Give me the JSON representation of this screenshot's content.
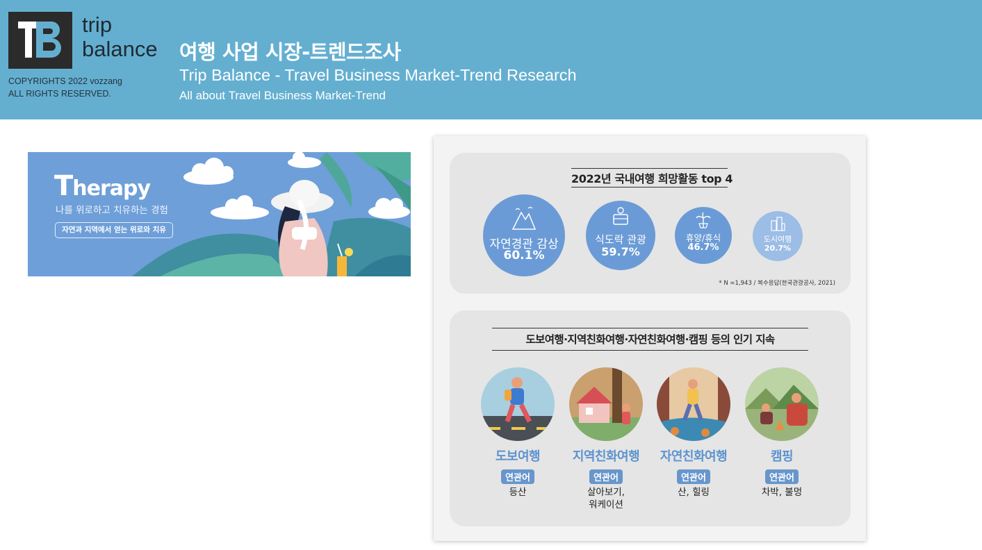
{
  "header": {
    "logo_initials": "TB",
    "logo_word_line1": "trip",
    "logo_word_line2": "balance",
    "copyright_line1": "COPYRIGHTS 2022 vozzang",
    "copyright_line2": "ALL RIGHTS RESERVED.",
    "title_ko": "여행 사업 시장-트렌드조사",
    "title_en": "Trip Balance - Travel Business Market-Trend Research",
    "subtitle": "All about Travel Business Market-Trend",
    "bg_color": "#64afd0"
  },
  "banner": {
    "title_first": "T",
    "title_rest": "herapy",
    "subtitle": "나를 위로하고 치유하는 경험",
    "pill": "자연과 지역에서 얻는 위로와 치유"
  },
  "infographic": {
    "top4": {
      "title": "2022년 국내여행 희망활동 top 4",
      "items": [
        {
          "label": "자연경관 감상",
          "value": "60.1%",
          "icon": "mountain-icon"
        },
        {
          "label": "식도락 관광",
          "value": "59.7%",
          "icon": "food-icon"
        },
        {
          "label": "휴양/휴식",
          "value": "46.7%",
          "icon": "palm-icon"
        },
        {
          "label": "도시여행",
          "value": "20.7%",
          "icon": "city-icon"
        }
      ],
      "note": "* N =1,943 / 복수응답(한국관광공사, 2021)",
      "bubble_color": "#6b9bd6"
    },
    "trends": {
      "title": "도보여행·지역친화여행·자연친화여행·캠핑 등의 인기 지속",
      "tag_label": "연관어",
      "items": [
        {
          "name": "도보여행",
          "keywords_line1": "등산",
          "keywords_line2": ""
        },
        {
          "name": "지역친화여행",
          "keywords_line1": "살아보기,",
          "keywords_line2": "워케이션"
        },
        {
          "name": "자연친화여행",
          "keywords_line1": "산, 힐링",
          "keywords_line2": ""
        },
        {
          "name": "캠핑",
          "keywords_line1": "차박, 불멍",
          "keywords_line2": ""
        }
      ],
      "accent_color": "#5c93cf"
    }
  }
}
